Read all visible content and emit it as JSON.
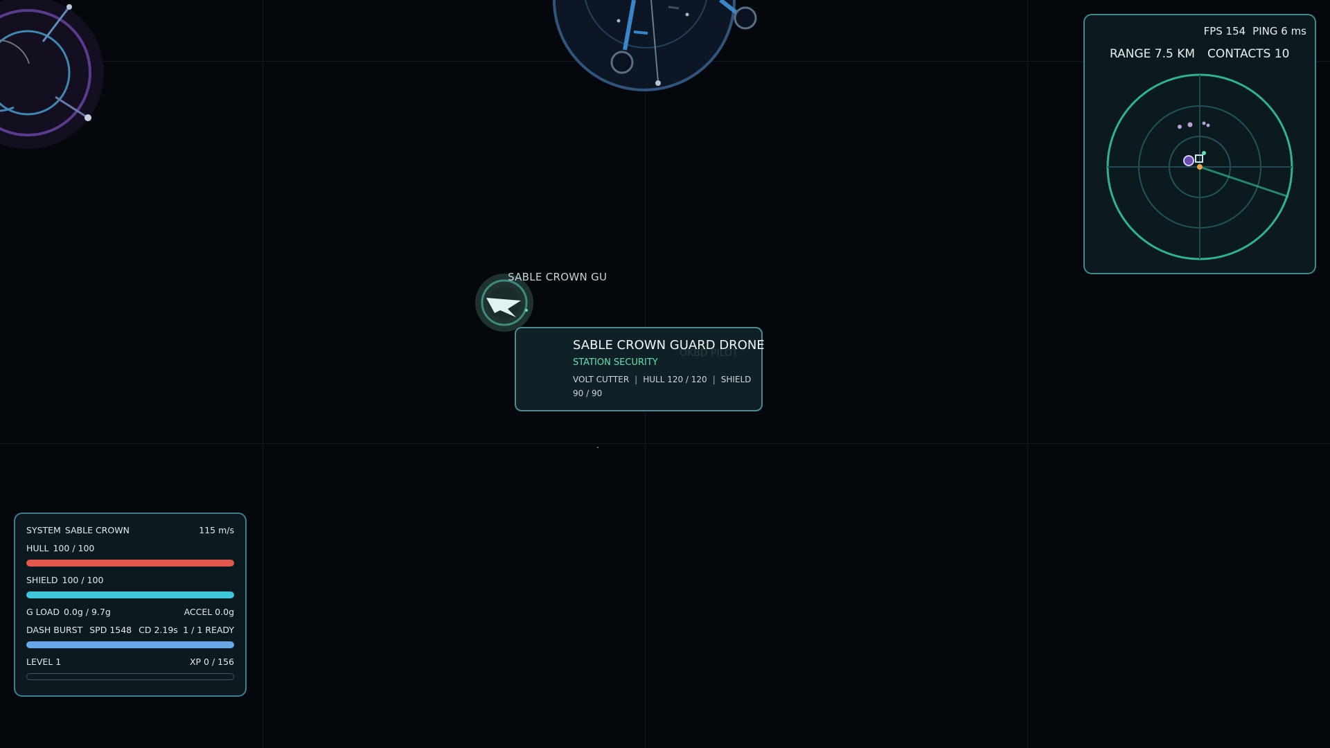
{
  "target": {
    "nameplate": "SABLE CROWN GU",
    "title": "SABLE CROWN GUARD DRONE",
    "faction": "STATION SECURITY",
    "weapon": "VOLT CUTTER",
    "hull": "HULL 120 / 120",
    "shield_label": "SHIELD",
    "shield_value": "90 / 90",
    "obscured_label": "OKBD PILOT"
  },
  "radar": {
    "fps": "FPS 154",
    "ping": "PING 6 ms",
    "range": "RANGE 7.5 KM",
    "contacts": "CONTACTS 10"
  },
  "status": {
    "system_label": "SYSTEM",
    "system_name": "SABLE CROWN",
    "speed": "115 m/s",
    "hull_label": "HULL",
    "hull_value": "100 / 100",
    "hull_fraction": 1.0,
    "shield_label": "SHIELD",
    "shield_value": "100 / 100",
    "shield_fraction": 1.0,
    "gload_label": "G LOAD",
    "gload_value": "0.0g / 9.7g",
    "accel": "ACCEL 0.0g",
    "dash_label": "DASH BURST",
    "dash_spd": "SPD 1548",
    "dash_cd": "CD 2.19s",
    "dash_ready": "1 / 1 READY",
    "dash_fraction": 1.0,
    "level": "LEVEL 1",
    "xp": "XP 0 / 156",
    "xp_fraction": 0.0
  },
  "colors": {
    "hull": "#e4574d",
    "shield": "#3fc6dc",
    "dash": "#6aa7e8",
    "radar_ring": "#2fb48e",
    "accent": "#64e0b4"
  },
  "icons": {
    "drone": "drone-ship-icon",
    "station": "station-icon",
    "player": "player-ship-icon"
  }
}
